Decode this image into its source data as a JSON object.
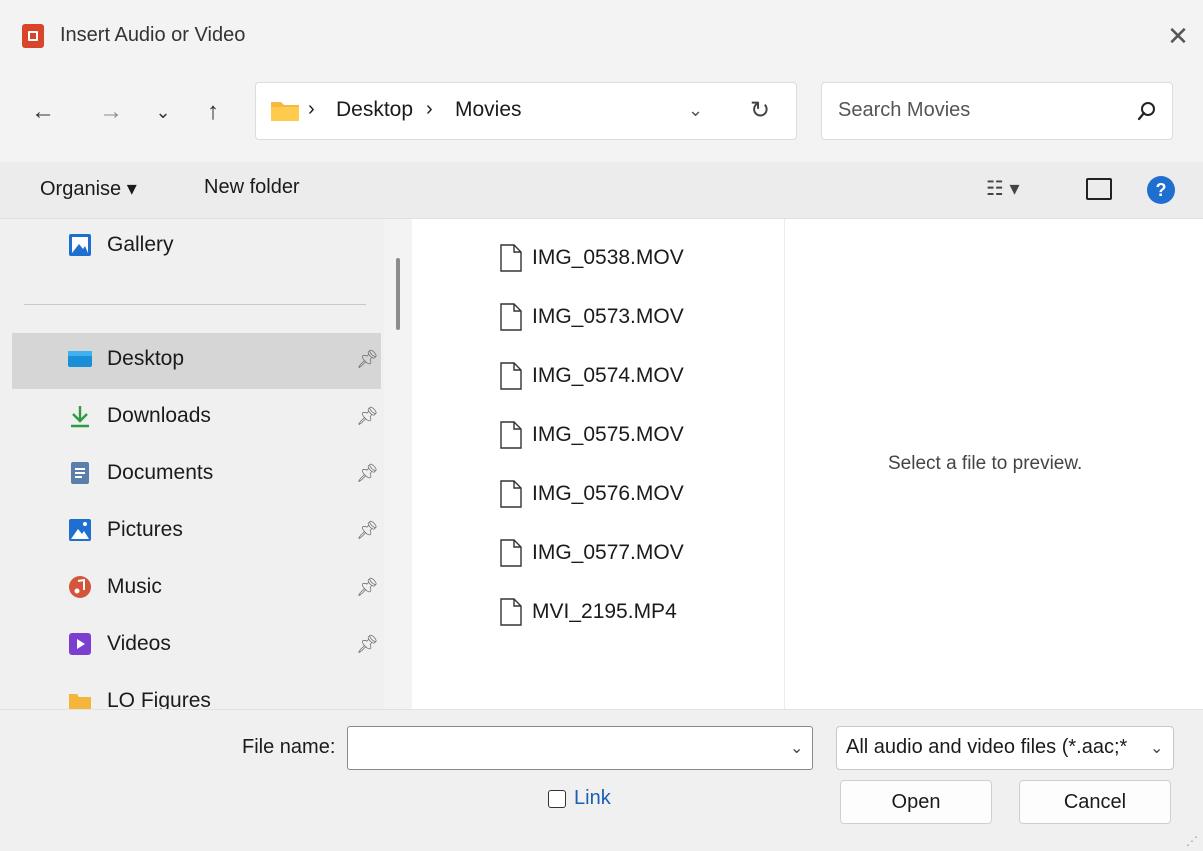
{
  "window": {
    "title": "Insert Audio or Video",
    "close_label": "✕"
  },
  "nav": {
    "back": "←",
    "forward": "→",
    "recent": "⌄",
    "up": "↑",
    "breadcrumb": [
      "Desktop",
      "Movies"
    ],
    "breadcrumb_separator": "›",
    "search_placeholder": "Search Movies"
  },
  "toolbar": {
    "organise_label": "Organise ▾",
    "new_folder_label": "New folder",
    "view_label": "☷ ▾",
    "help_label": "?"
  },
  "sidebar": {
    "items": [
      {
        "label": "Gallery",
        "icon": "gallery-icon",
        "color": "#1f6fd0",
        "pinned": false
      },
      {
        "label": "Desktop",
        "icon": "desktop-icon",
        "color": "#1a8fd8",
        "pinned": true,
        "selected": true
      },
      {
        "label": "Downloads",
        "icon": "download-icon",
        "color": "#2e9a44",
        "pinned": true
      },
      {
        "label": "Documents",
        "icon": "documents-icon",
        "color": "#5b7faa",
        "pinned": true
      },
      {
        "label": "Pictures",
        "icon": "pictures-icon",
        "color": "#1f6fd0",
        "pinned": true
      },
      {
        "label": "Music",
        "icon": "music-icon",
        "color": "#d4553a",
        "pinned": true
      },
      {
        "label": "Videos",
        "icon": "videos-icon",
        "color": "#7a3fd1",
        "pinned": true
      },
      {
        "label": "LO Figures",
        "icon": "folder-icon",
        "color": "#f3b63b",
        "pinned": false
      }
    ]
  },
  "files": [
    "IMG_0538.MOV",
    "IMG_0573.MOV",
    "IMG_0574.MOV",
    "IMG_0575.MOV",
    "IMG_0576.MOV",
    "IMG_0577.MOV",
    "MVI_2195.MP4"
  ],
  "preview": {
    "placeholder": "Select a file to preview."
  },
  "footer": {
    "file_name_label": "File name:",
    "file_name_value": "",
    "file_type": "All audio and video files (*.aac;*",
    "link_label": "Link",
    "open_label": "Open",
    "cancel_label": "Cancel"
  }
}
